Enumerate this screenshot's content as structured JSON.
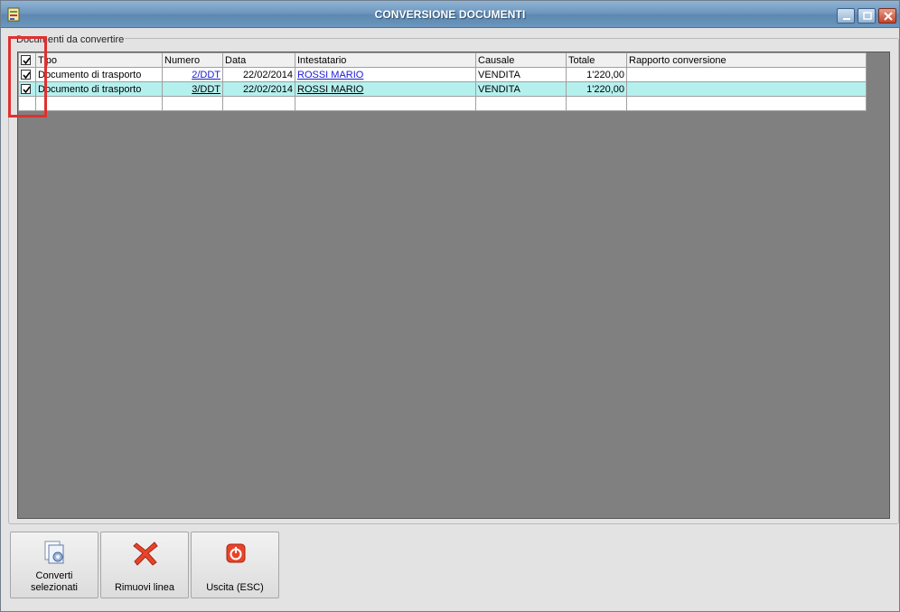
{
  "window": {
    "title": "CONVERSIONE DOCUMENTI"
  },
  "group": {
    "label": "Documenti da convertire"
  },
  "grid": {
    "columns": [
      "Tipo",
      "Numero",
      "Data",
      "Intestatario",
      "Causale",
      "Totale",
      "Rapporto conversione"
    ],
    "rows": [
      {
        "checked": true,
        "tipo": "Documento di trasporto",
        "numero": "2/DDT",
        "data": "22/02/2014",
        "intestatario": "ROSSI MARIO",
        "causale": "VENDITA",
        "totale": "1'220,00",
        "rapporto": ""
      },
      {
        "checked": true,
        "tipo": "Documento di trasporto",
        "numero": "3/DDT",
        "data": "22/02/2014",
        "intestatario": "ROSSI MARIO",
        "causale": "VENDITA",
        "totale": "1'220,00",
        "rapporto": ""
      }
    ]
  },
  "buttons": {
    "convert_line1": "Converti",
    "convert_line2": "selezionati",
    "remove": "Rimuovi linea",
    "exit": "Uscita (ESC)"
  },
  "icons": {
    "app": "app-icon",
    "convert": "documents-gear-icon",
    "remove": "red-x-icon",
    "exit": "power-icon"
  },
  "colors": {
    "titlebar": "#6e98bf",
    "selected_row": "#b4f0ee",
    "link": "#1a1ad6",
    "highlight": "#e03030"
  }
}
